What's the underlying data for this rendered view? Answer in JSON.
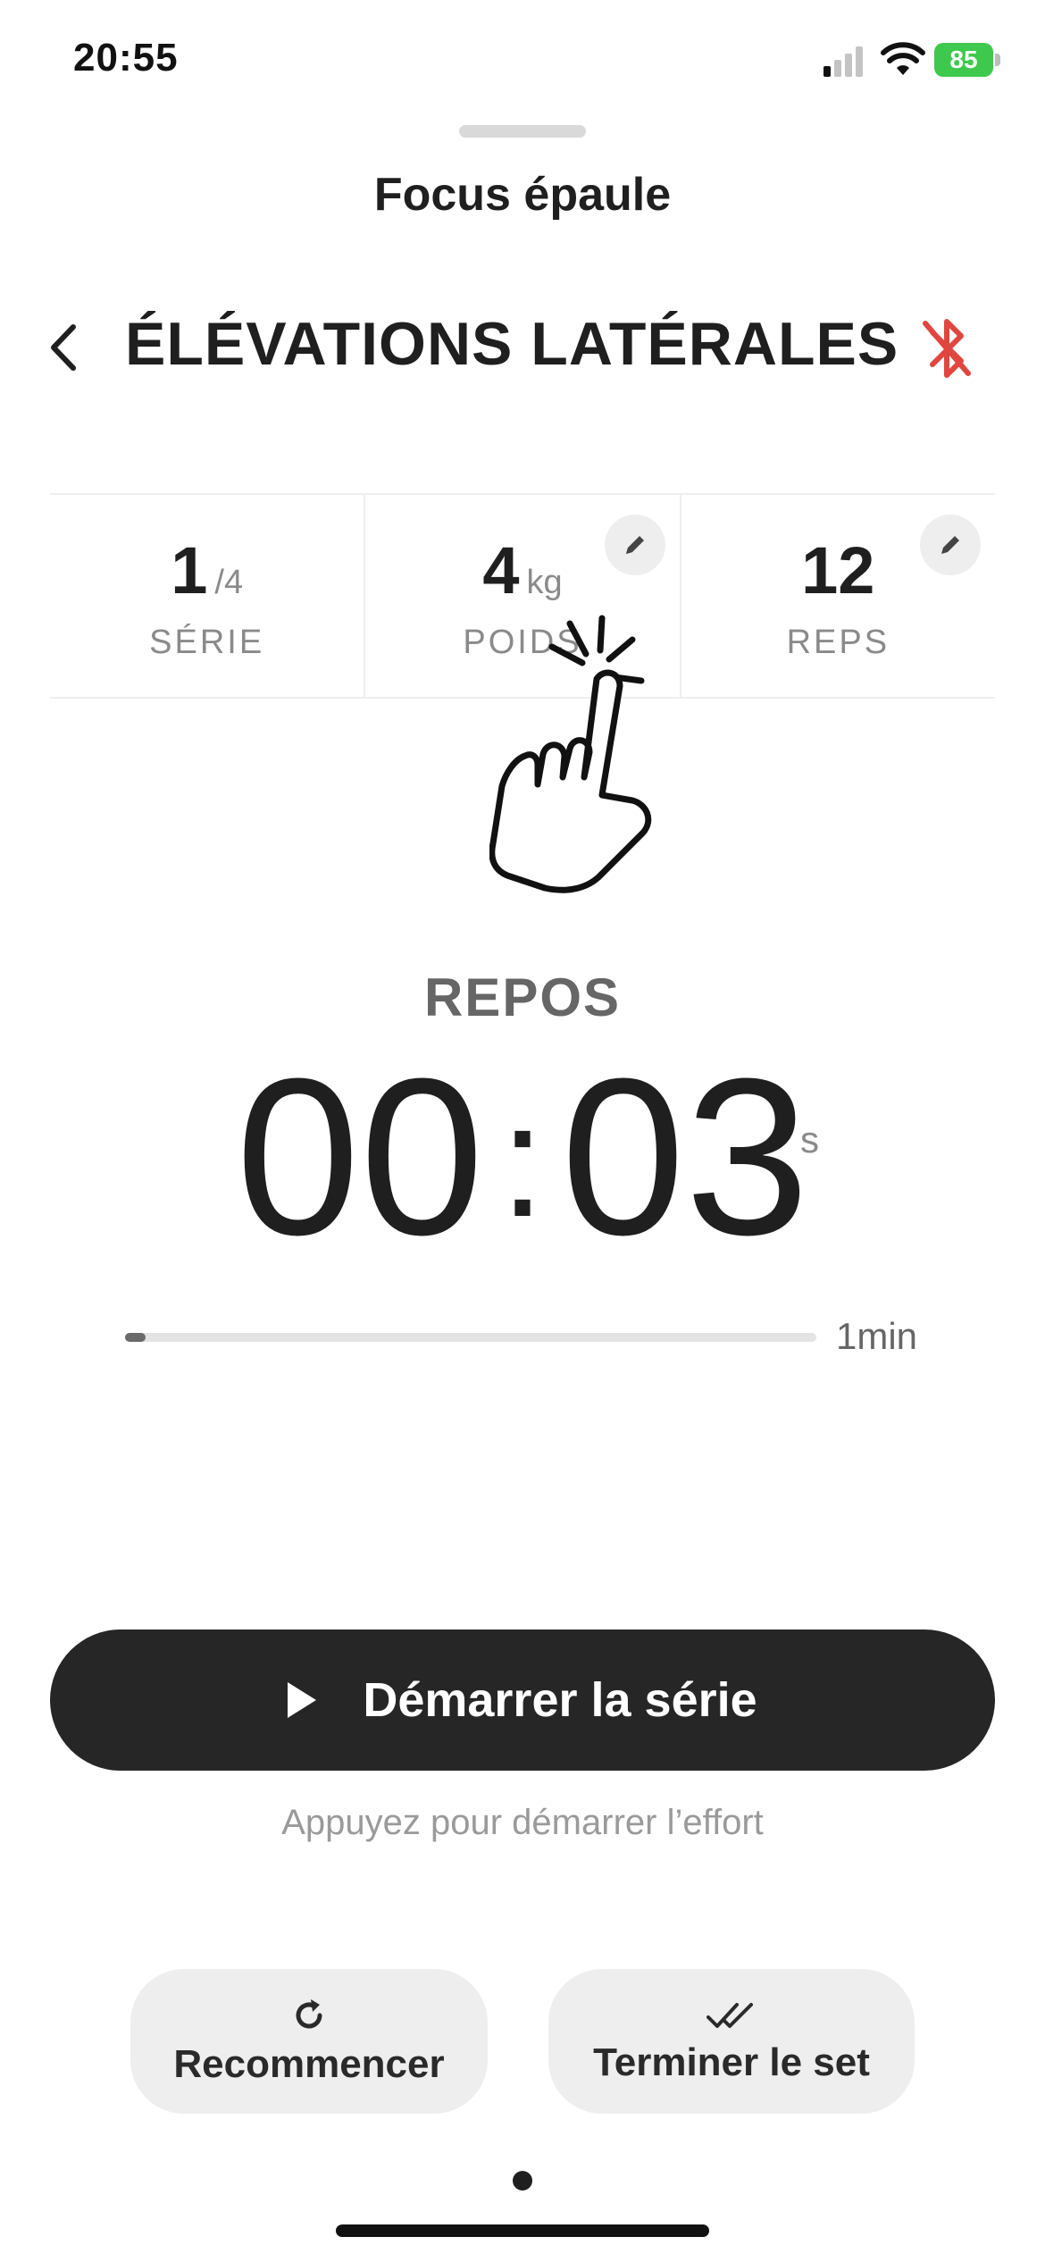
{
  "status_bar": {
    "time": "20:55",
    "battery": "85"
  },
  "sheet": {
    "title": "Focus épaule"
  },
  "exercise": {
    "title": "ÉLÉVATIONS LATÉRALES"
  },
  "stats": [
    {
      "value": "1",
      "unit": "/4",
      "label": "SÉRIE"
    },
    {
      "value": "4",
      "unit": "kg",
      "label": "POIDS"
    },
    {
      "value": "12",
      "unit": "",
      "label": "REPS"
    }
  ],
  "rest": {
    "label": "REPOS",
    "minutes": "00",
    "separator": ":",
    "seconds": "03",
    "unit": "s",
    "progress_fraction": 0.03,
    "max_label": "1min"
  },
  "start_button": {
    "label": "Démarrer la série"
  },
  "hint": "Appuyez pour démarrer l’effort",
  "actions": {
    "restart_label": "Recommencer",
    "finish_label": "Terminer le set"
  },
  "colors": {
    "accent_dark": "#262626",
    "bluetooth_red": "#e0463f",
    "battery_green": "#3fc84e"
  },
  "icons": [
    "signal-icon",
    "wifi-icon",
    "battery-icon",
    "back-chevron-icon",
    "bluetooth-off-icon",
    "pencil-icon",
    "tap-hand-icon",
    "play-icon",
    "restart-icon",
    "double-check-icon"
  ]
}
